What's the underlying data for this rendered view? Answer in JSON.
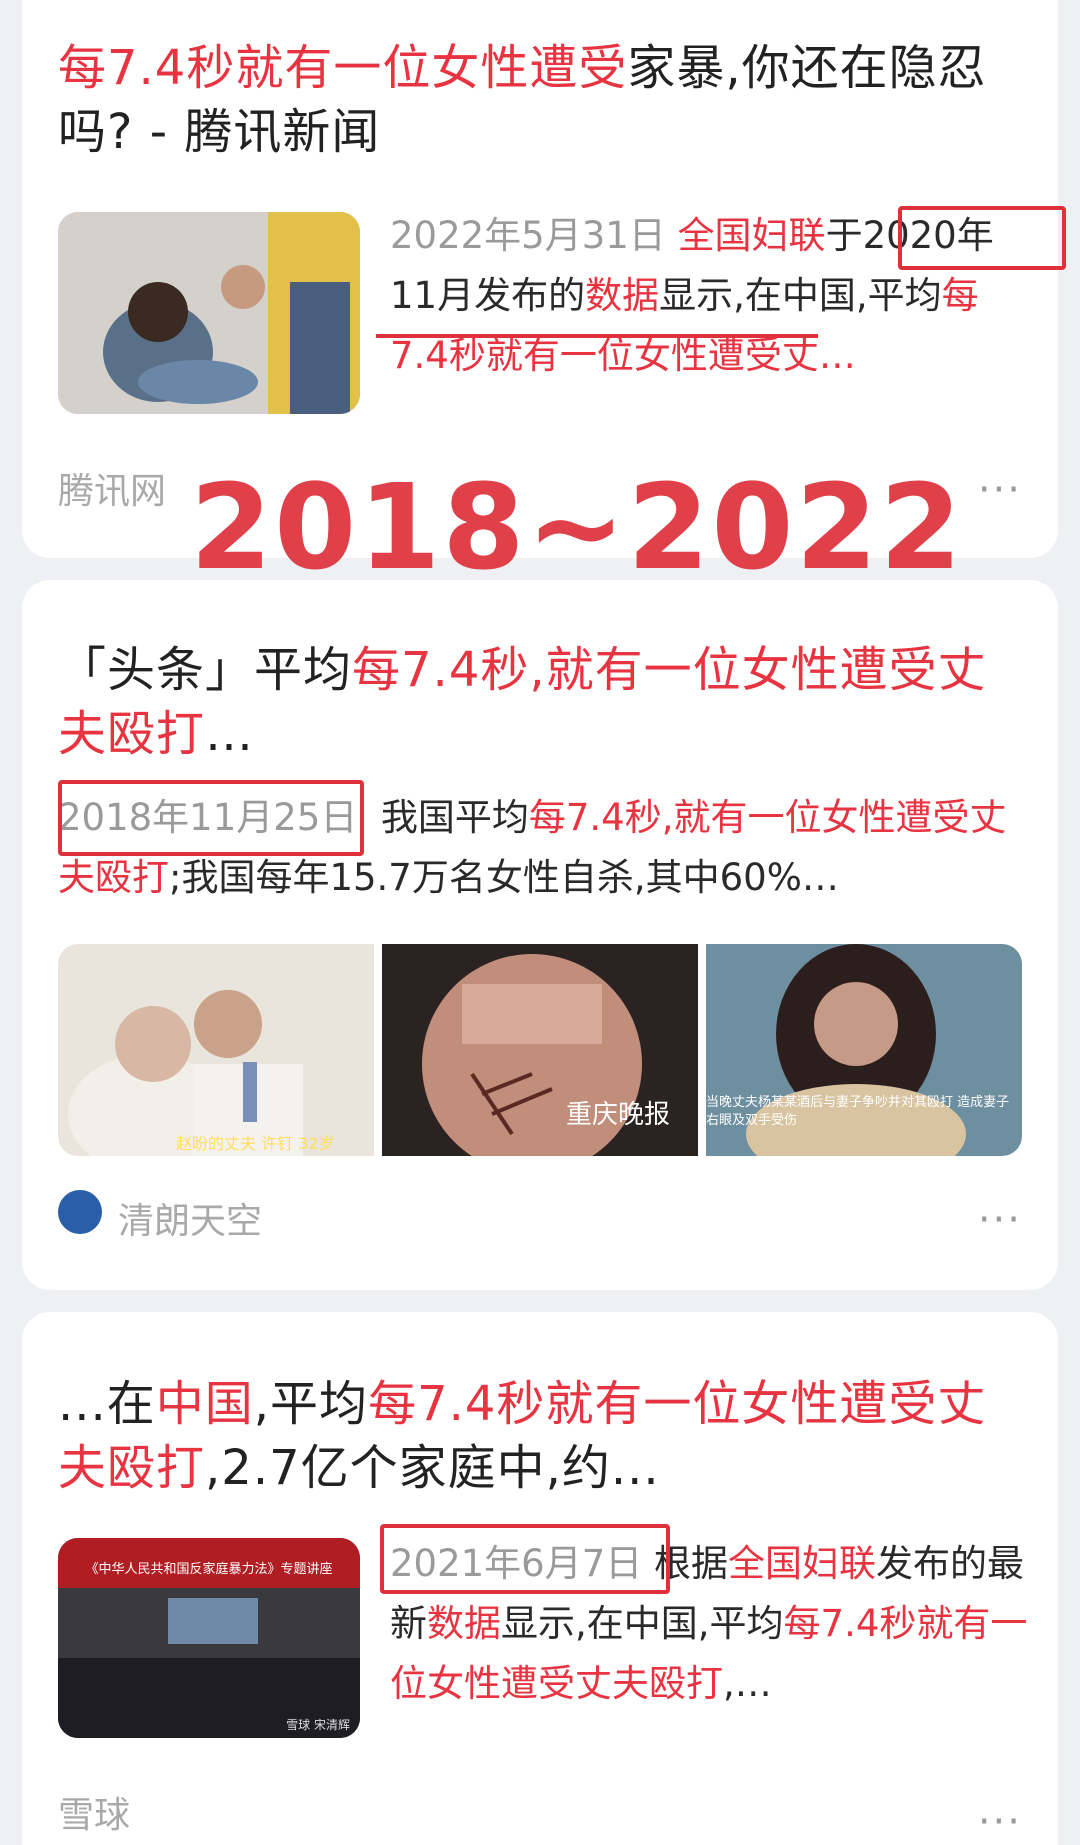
{
  "cards": [
    {
      "title_red": "每7.4秒就有一位女性遭受",
      "title_rest": "家暴,你还在隐忍吗? - 腾讯新闻",
      "date": "2022年5月31日",
      "snippet_parts": [
        {
          "t": "全国妇联",
          "red": true
        },
        {
          "t": "于",
          "red": false
        },
        {
          "t": "2020年11月发布的",
          "red": false
        },
        {
          "t": "数据",
          "red": true
        },
        {
          "t": "显示,在中国,平均",
          "red": false
        },
        {
          "t": "每7.4秒就有一位女性遭受丈…",
          "red": true
        }
      ],
      "source": "腾讯网",
      "more": "···"
    },
    {
      "title_black1": "「头条」平均",
      "title_red": "每7.4秒,就有一位女性遭受丈夫殴打",
      "title_rest": "…",
      "date": "2018年11月25日",
      "snippet_black1": "我国平均",
      "snippet_red": "每7.4秒,就有一位女性遭受丈夫殴打",
      "snippet_rest": ";我国每年15.7万名女性自杀,其中60%…",
      "image_captions": [
        "赵盼的丈夫 许钉 32岁",
        "重庆晚报",
        "当晚丈夫杨某某酒后与妻子争吵并对其殴打 造成妻子右眼及双手受伤"
      ],
      "source": "清朗天空",
      "more": "···"
    },
    {
      "title_black1": "...在",
      "title_red1": "中国",
      "title_black2": ",平均",
      "title_red2": "每7.4秒就有一位女性遭受丈夫殴打",
      "title_rest": ",2.7亿个家庭中,约...",
      "date": "2021年6月7日",
      "snippet_black1": "根据",
      "snippet_red1": "全国妇联",
      "snippet_black2": "发布的最新",
      "snippet_red2": "数据",
      "snippet_black3": "显示,在中国,平均",
      "snippet_red3": "每7.4秒就有一位女性遭受丈夫殴打",
      "snippet_rest": ",…",
      "image_caption": "《中华人民共和国反家庭暴力法》专题讲座",
      "image_watermark": "雪球 宋清辉",
      "source": "雪球",
      "more": "···"
    }
  ],
  "overlay": "2018~2022",
  "colors": {
    "accent_red": "#e83340",
    "box_red": "#e0303c",
    "bg": "#eef0f4",
    "card": "#ffffff"
  }
}
